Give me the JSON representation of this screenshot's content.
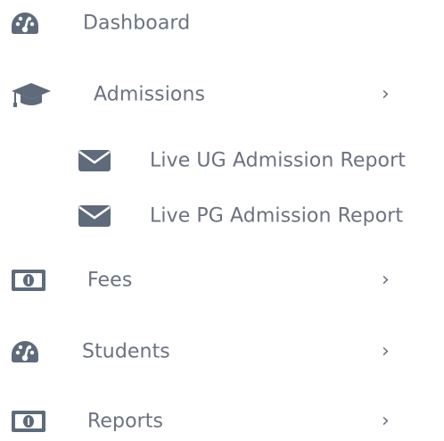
{
  "menu": {
    "dashboard": {
      "label": "Dashboard",
      "icon": "dashboard-gauge-icon"
    },
    "admissions": {
      "label": "Admissions",
      "icon": "graduation-cap-icon",
      "chevron": "›",
      "children": [
        {
          "label": "Live UG Admission Report",
          "icon": "envelope-icon"
        },
        {
          "label": "Live PG Admission Report",
          "icon": "envelope-icon"
        }
      ]
    },
    "fees": {
      "label": "Fees",
      "icon": "money-bill-icon",
      "chevron": "›"
    },
    "students": {
      "label": "Students",
      "icon": "dashboard-gauge-icon",
      "chevron": "›"
    },
    "reports": {
      "label": "Reports",
      "icon": "money-bill-icon",
      "chevron": "›"
    }
  },
  "colors": {
    "text": "#6b7280",
    "icon": "#5f6b7a"
  }
}
